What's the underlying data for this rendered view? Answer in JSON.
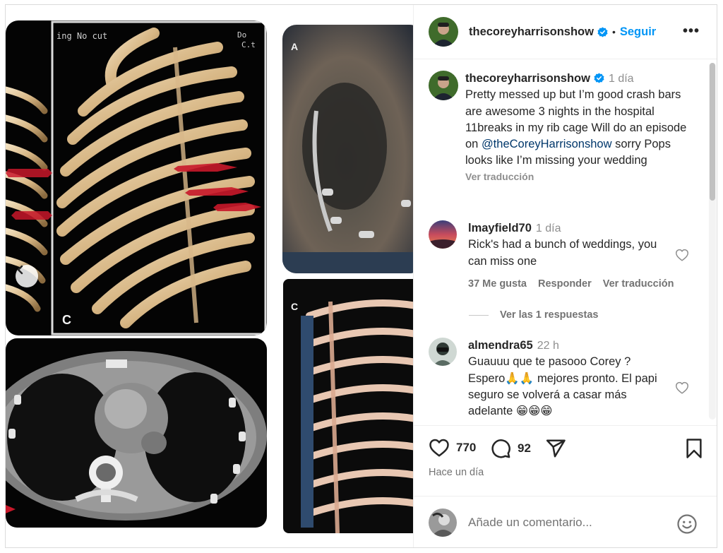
{
  "post": {
    "username": "thecoreyharrisonshow",
    "follow_label": "Seguir",
    "more_label": "•••",
    "sep": "•"
  },
  "caption": {
    "username": "thecoreyharrisonshow",
    "time": "1 día",
    "text_before": "Pretty messed up but I’m good crash bars are awesome 3 nights in the hospital 11breaks in my rib cage Will do an episode on ",
    "mention": "@theCoreyHarrisonshow",
    "text_after": " sorry Pops looks like I’m missing your wedding",
    "translate": "Ver traducción"
  },
  "comments": [
    {
      "username": "lmayfield70",
      "time": "1 día",
      "text": "Rick's had a bunch of weddings, you can miss one",
      "likes": "37 Me gusta",
      "reply": "Responder",
      "translate": "Ver traducción",
      "view_replies": "Ver las 1 respuestas"
    },
    {
      "username": "almendra65",
      "time": "22 h",
      "text": "Guauuu que te pasooo Corey ? Espero🙏🙏 mejores pronto. El papi seguro se volverá a casar más adelante 😁😁😁"
    }
  ],
  "stats": {
    "likes": "770",
    "comments": "92",
    "posted": "Hace un día"
  },
  "add_comment": {
    "placeholder": "Añade un comentario..."
  },
  "media": {
    "label_a": "A",
    "label_c": "C",
    "label_c2": "C",
    "ct_label": "ing  No cut",
    "corner_text": "Do",
    "corner_text2": "C.t",
    "carousel_total": 3,
    "carousel_active": 3
  },
  "colors": {
    "accent": "#0095f6",
    "text": "#262626",
    "muted": "#737373",
    "mention": "#00376b"
  }
}
